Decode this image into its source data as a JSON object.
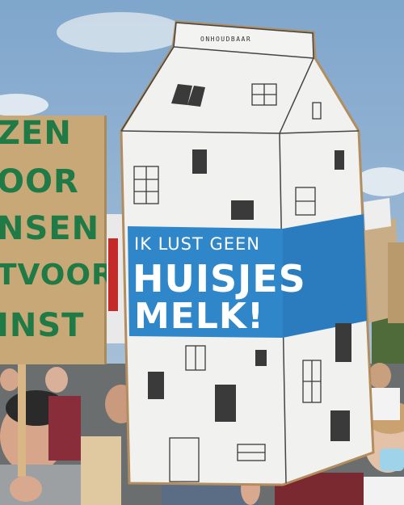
{
  "left_sign": {
    "lines": [
      "ZEN",
      "OOR",
      "NSEN",
      "TVOOR",
      "INST"
    ]
  },
  "carton": {
    "top_label": "ONHOUDBAAR",
    "line1": "IK LUST GEEN",
    "line2": "HUISJES",
    "line3": "MELK!"
  },
  "colors": {
    "sky": "#8fb2d4",
    "carton_white": "#f1f1ef",
    "carton_blue": "#2f86c8",
    "sign_cardboard": "#c9a878",
    "sign_green": "#1f7a45"
  }
}
